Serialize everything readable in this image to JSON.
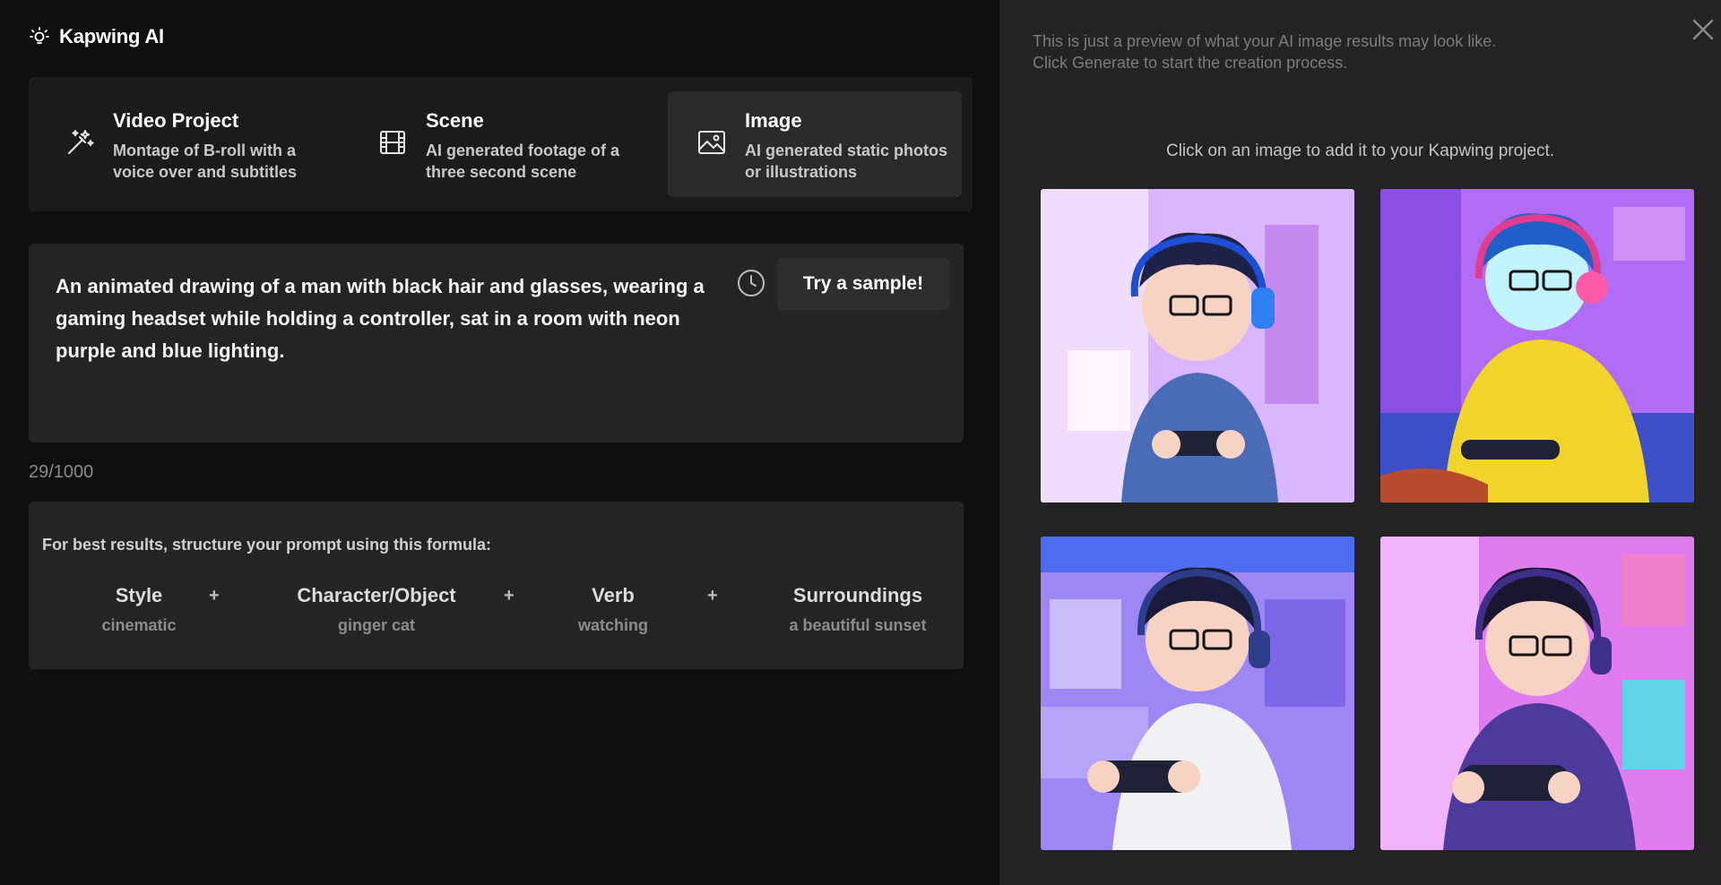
{
  "app": {
    "title": "Kapwing AI",
    "logo_icon": "lightbulb-icon"
  },
  "modes": [
    {
      "title": "Video Project",
      "desc": "Montage of B-roll with a voice over and subtitles",
      "icon": "magic-wand-icon",
      "selected": false
    },
    {
      "title": "Scene",
      "desc": "AI generated footage of a three second scene",
      "icon": "film-icon",
      "selected": false
    },
    {
      "title": "Image",
      "desc": "AI generated static photos or illustrations",
      "icon": "image-icon",
      "selected": true
    }
  ],
  "prompt": {
    "text": "An animated drawing of a man with black hair and glasses, wearing a gaming headset while holding a controller, sat in a room with neon purple and blue lighting.",
    "sample_button": "Try a sample!",
    "history_icon": "clock-icon",
    "counter": "29/1000"
  },
  "formula": {
    "intro": "For best results, structure your prompt using this formula:",
    "items": [
      {
        "label": "Style",
        "example": "cinematic"
      },
      {
        "label": "Character/Object",
        "example": "ginger cat"
      },
      {
        "label": "Verb",
        "example": "watching"
      },
      {
        "label": "Surroundings",
        "example": "a beautiful sunset"
      }
    ],
    "plus": "+"
  },
  "preview": {
    "note": "This is just a preview of what your AI image results may look like. Click Generate to start the creation process.",
    "click_note": "Click on an image to add it to your Kapwing project.",
    "close_icon": "close-icon",
    "thumbnails": [
      {
        "name": "gamer-blue-hoodie",
        "bg": "#d9b6ff",
        "shirt": "#4a6bb5"
      },
      {
        "name": "gamer-yellow-shirt",
        "bg": "#b06cf5",
        "shirt": "#f3d42a"
      },
      {
        "name": "gamer-white-sweater",
        "bg": "#9f86f5",
        "shirt": "#f1f1f4"
      },
      {
        "name": "gamer-purple-hoodie",
        "bg": "#e07bf0",
        "shirt": "#4d3a9c"
      }
    ]
  },
  "colors": {
    "left_bg": "#0f0f0f",
    "right_bg": "#232323",
    "card_bg": "#242424",
    "selected_mode_bg": "#2a2a2a"
  }
}
